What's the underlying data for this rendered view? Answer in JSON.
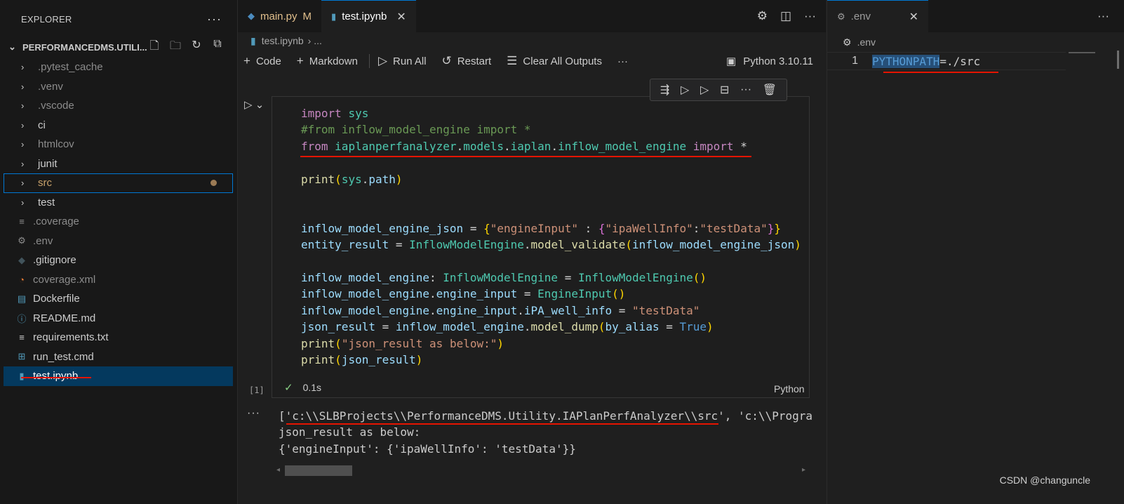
{
  "explorer": {
    "title": "EXPLORER",
    "project": "PERFORMANCEDMS.UTILI...",
    "items": [
      {
        "label": ".pytest_cache",
        "kind": "folder",
        "dim": true
      },
      {
        "label": ".venv",
        "kind": "folder",
        "dim": true
      },
      {
        "label": ".vscode",
        "kind": "folder",
        "dim": true
      },
      {
        "label": "ci",
        "kind": "folder",
        "dim": false
      },
      {
        "label": "htmlcov",
        "kind": "folder",
        "dim": true
      },
      {
        "label": "junit",
        "kind": "folder",
        "dim": false
      },
      {
        "label": "src",
        "kind": "folder",
        "dim": false
      },
      {
        "label": "test",
        "kind": "folder",
        "dim": false
      },
      {
        "label": ".coverage",
        "kind": "file",
        "dim": true
      },
      {
        "label": ".env",
        "kind": "file",
        "dim": true
      },
      {
        "label": ".gitignore",
        "kind": "file",
        "dim": false
      },
      {
        "label": "coverage.xml",
        "kind": "file",
        "dim": true
      },
      {
        "label": "Dockerfile",
        "kind": "file",
        "dim": false
      },
      {
        "label": "README.md",
        "kind": "file",
        "dim": false
      },
      {
        "label": "requirements.txt",
        "kind": "file",
        "dim": false
      },
      {
        "label": "run_test.cmd",
        "kind": "file",
        "dim": false
      },
      {
        "label": "test.ipynb",
        "kind": "file",
        "dim": false
      }
    ]
  },
  "editor1": {
    "tabs": [
      {
        "label": "main.py",
        "badge": "M"
      },
      {
        "label": "test.ipynb"
      }
    ],
    "breadcrumb": {
      "file": "test.ipynb",
      "rest": "› ..."
    },
    "toolbar": {
      "code": "Code",
      "markdown": "Markdown",
      "run_all": "Run All",
      "restart": "Restart",
      "clear": "Clear All Outputs",
      "kernel": "Python 3.10.11"
    },
    "cell": {
      "exec_count": "[1]",
      "duration": "0.1s",
      "language": "Python"
    },
    "output": {
      "line1": "['c:\\\\SLBProjects\\\\PerformanceDMS.Utility.IAPlanPerfAnalyzer\\\\src', 'c:\\\\Programs",
      "line2": "json_result as below:",
      "line3": "{'engineInput': {'ipaWellInfo': 'testData'}}"
    }
  },
  "editor2": {
    "tab": ".env",
    "breadcrumb": ".env",
    "line_no": "1",
    "key": "PYTHONPATH",
    "value": "=./src"
  },
  "watermark": "CSDN @changuncle",
  "colors": {
    "accent": "#0078d4",
    "annotation": "#e51400",
    "selection": "#04395e"
  }
}
